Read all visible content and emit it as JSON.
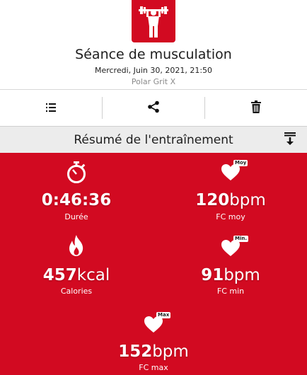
{
  "session": {
    "title": "Séance de musculation",
    "date": "Mercredi, Juin 30, 2021, 21:50",
    "device": "Polar Grit X"
  },
  "toolbar": {
    "items": [
      {
        "name": "list",
        "icon": "list-icon"
      },
      {
        "name": "share",
        "icon": "share-icon"
      },
      {
        "name": "delete",
        "icon": "trash-icon"
      }
    ]
  },
  "summary": {
    "title": "Résumé de l'entraînement",
    "stats": {
      "duration": {
        "value": "0:46:36",
        "unit": "",
        "label": "Durée",
        "icon": "stopwatch-icon"
      },
      "hr_avg": {
        "value": "120",
        "unit": "bpm",
        "label": "FC moy",
        "badge": "Moy",
        "icon": "heart-icon"
      },
      "calories": {
        "value": "457",
        "unit": "kcal",
        "label": "Calories",
        "icon": "flame-icon"
      },
      "hr_min": {
        "value": "91",
        "unit": "bpm",
        "label": "FC min",
        "badge": "Min.",
        "icon": "heart-icon"
      },
      "hr_max": {
        "value": "152",
        "unit": "bpm",
        "label": "FC max",
        "badge": "Max",
        "icon": "heart-icon"
      }
    }
  },
  "colors": {
    "accent": "#d20a21",
    "bar": "#ececec"
  }
}
